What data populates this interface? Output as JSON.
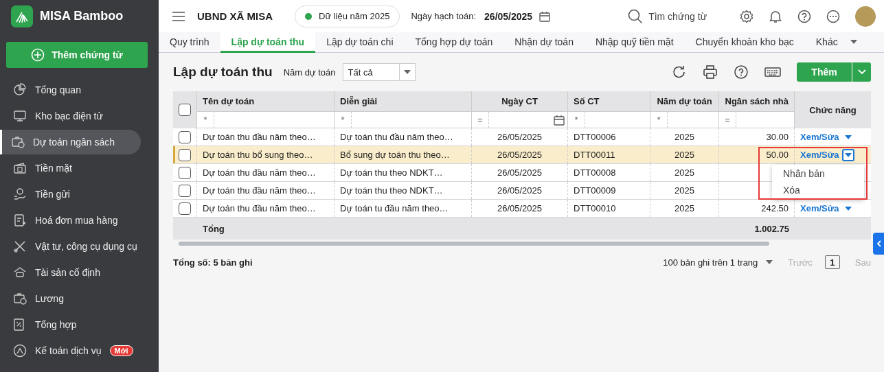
{
  "app": {
    "name": "MISA Bamboo"
  },
  "sidebar": {
    "add_button": "Thêm chứng từ",
    "items": [
      {
        "label": "Tổng quan",
        "selected": false
      },
      {
        "label": "Kho bạc điện tử",
        "selected": false
      },
      {
        "label": "Dự toán ngân sách",
        "selected": true
      },
      {
        "label": "Tiền mặt",
        "selected": false
      },
      {
        "label": "Tiền gửi",
        "selected": false
      },
      {
        "label": "Hoá đơn mua hàng",
        "selected": false
      },
      {
        "label": "Vật tư, công cụ dụng cụ",
        "selected": false
      },
      {
        "label": "Tài sản cố định",
        "selected": false
      },
      {
        "label": "Lương",
        "selected": false
      },
      {
        "label": "Tổng hợp",
        "selected": false
      },
      {
        "label": "Kế toán dịch vụ",
        "selected": false,
        "badge": "Mới"
      }
    ]
  },
  "topbar": {
    "organization": "UBND XÃ MISA",
    "data_year": "Dữ liệu năm 2025",
    "posting_date_label": "Ngày hạch toán:",
    "posting_date": "26/05/2025",
    "search_placeholder": "Tìm chứng từ"
  },
  "tabs": [
    {
      "label": "Quy trình",
      "selected": false
    },
    {
      "label": "Lập dự toán thu",
      "selected": true
    },
    {
      "label": "Lập dự toán chi",
      "selected": false
    },
    {
      "label": "Tổng hợp dự toán",
      "selected": false
    },
    {
      "label": "Nhận dự toán",
      "selected": false
    },
    {
      "label": "Nhập quỹ tiền mặt",
      "selected": false
    },
    {
      "label": "Chuyển khoản kho bạc",
      "selected": false
    },
    {
      "label": "Khác",
      "selected": false
    }
  ],
  "page": {
    "title": "Lập dự toán thu",
    "year_filter_label": "Năm dự toán",
    "year_filter_value": "Tất cả",
    "add_button": "Thêm"
  },
  "table": {
    "columns": [
      "Tên dự toán",
      "Diễn giải",
      "Ngày CT",
      "Số CT",
      "Năm dự toán",
      "Ngân sách nhà",
      "Chức năng"
    ],
    "filters": [
      "*",
      "*",
      "=",
      "*",
      "*",
      "="
    ],
    "header_checked": false,
    "rows": [
      {
        "name": "Dự toán thu đầu năm theo…",
        "description": "Dự toán thu đầu năm theo…",
        "date": "26/05/2025",
        "number": "DTT00006",
        "year": "2025",
        "budget": "30.00",
        "action": "Xem/Sửa",
        "checked": false,
        "selected": false,
        "menu_open": false
      },
      {
        "name": "Dự toán thu bổ sung theo…",
        "description": "Bổ sung dự toán thu theo…",
        "date": "26/05/2025",
        "number": "DTT00011",
        "year": "2025",
        "budget": "50.00",
        "action": "Xem/Sửa",
        "checked": false,
        "selected": true,
        "menu_open": true
      },
      {
        "name": "Dự toán thu đầu năm theo…",
        "description": "Dự toán thu theo NDKT…",
        "date": "26/05/2025",
        "number": "DTT00008",
        "year": "2025",
        "checked": false,
        "selected": false
      },
      {
        "name": "Dự toán thu đầu năm theo…",
        "description": "Dự toán thu theo NDKT…",
        "date": "26/05/2025",
        "number": "DTT00009",
        "year": "2025",
        "checked": false,
        "selected": false
      },
      {
        "name": "Dự toán thu đầu năm theo…",
        "description": "Dự toán tu đầu năm theo…",
        "date": "26/05/2025",
        "number": "DTT00010",
        "year": "2025",
        "budget": "242.50",
        "action": "Xem/Sửa",
        "checked": false,
        "selected": false,
        "menu_open": false
      }
    ],
    "total_label": "Tổng",
    "total_value": "1.002.75"
  },
  "action_menu": {
    "items": [
      "Nhân bản",
      "Xóa"
    ]
  },
  "footer": {
    "total_records": "Tổng số: 5 bản ghi",
    "page_size": "100 bản ghi trên 1 trang",
    "prev": {
      "label": "Trước",
      "disabled": true
    },
    "pages": [
      {
        "label": "1",
        "selected": true
      }
    ],
    "next": {
      "label": "Sau",
      "disabled": true
    }
  }
}
